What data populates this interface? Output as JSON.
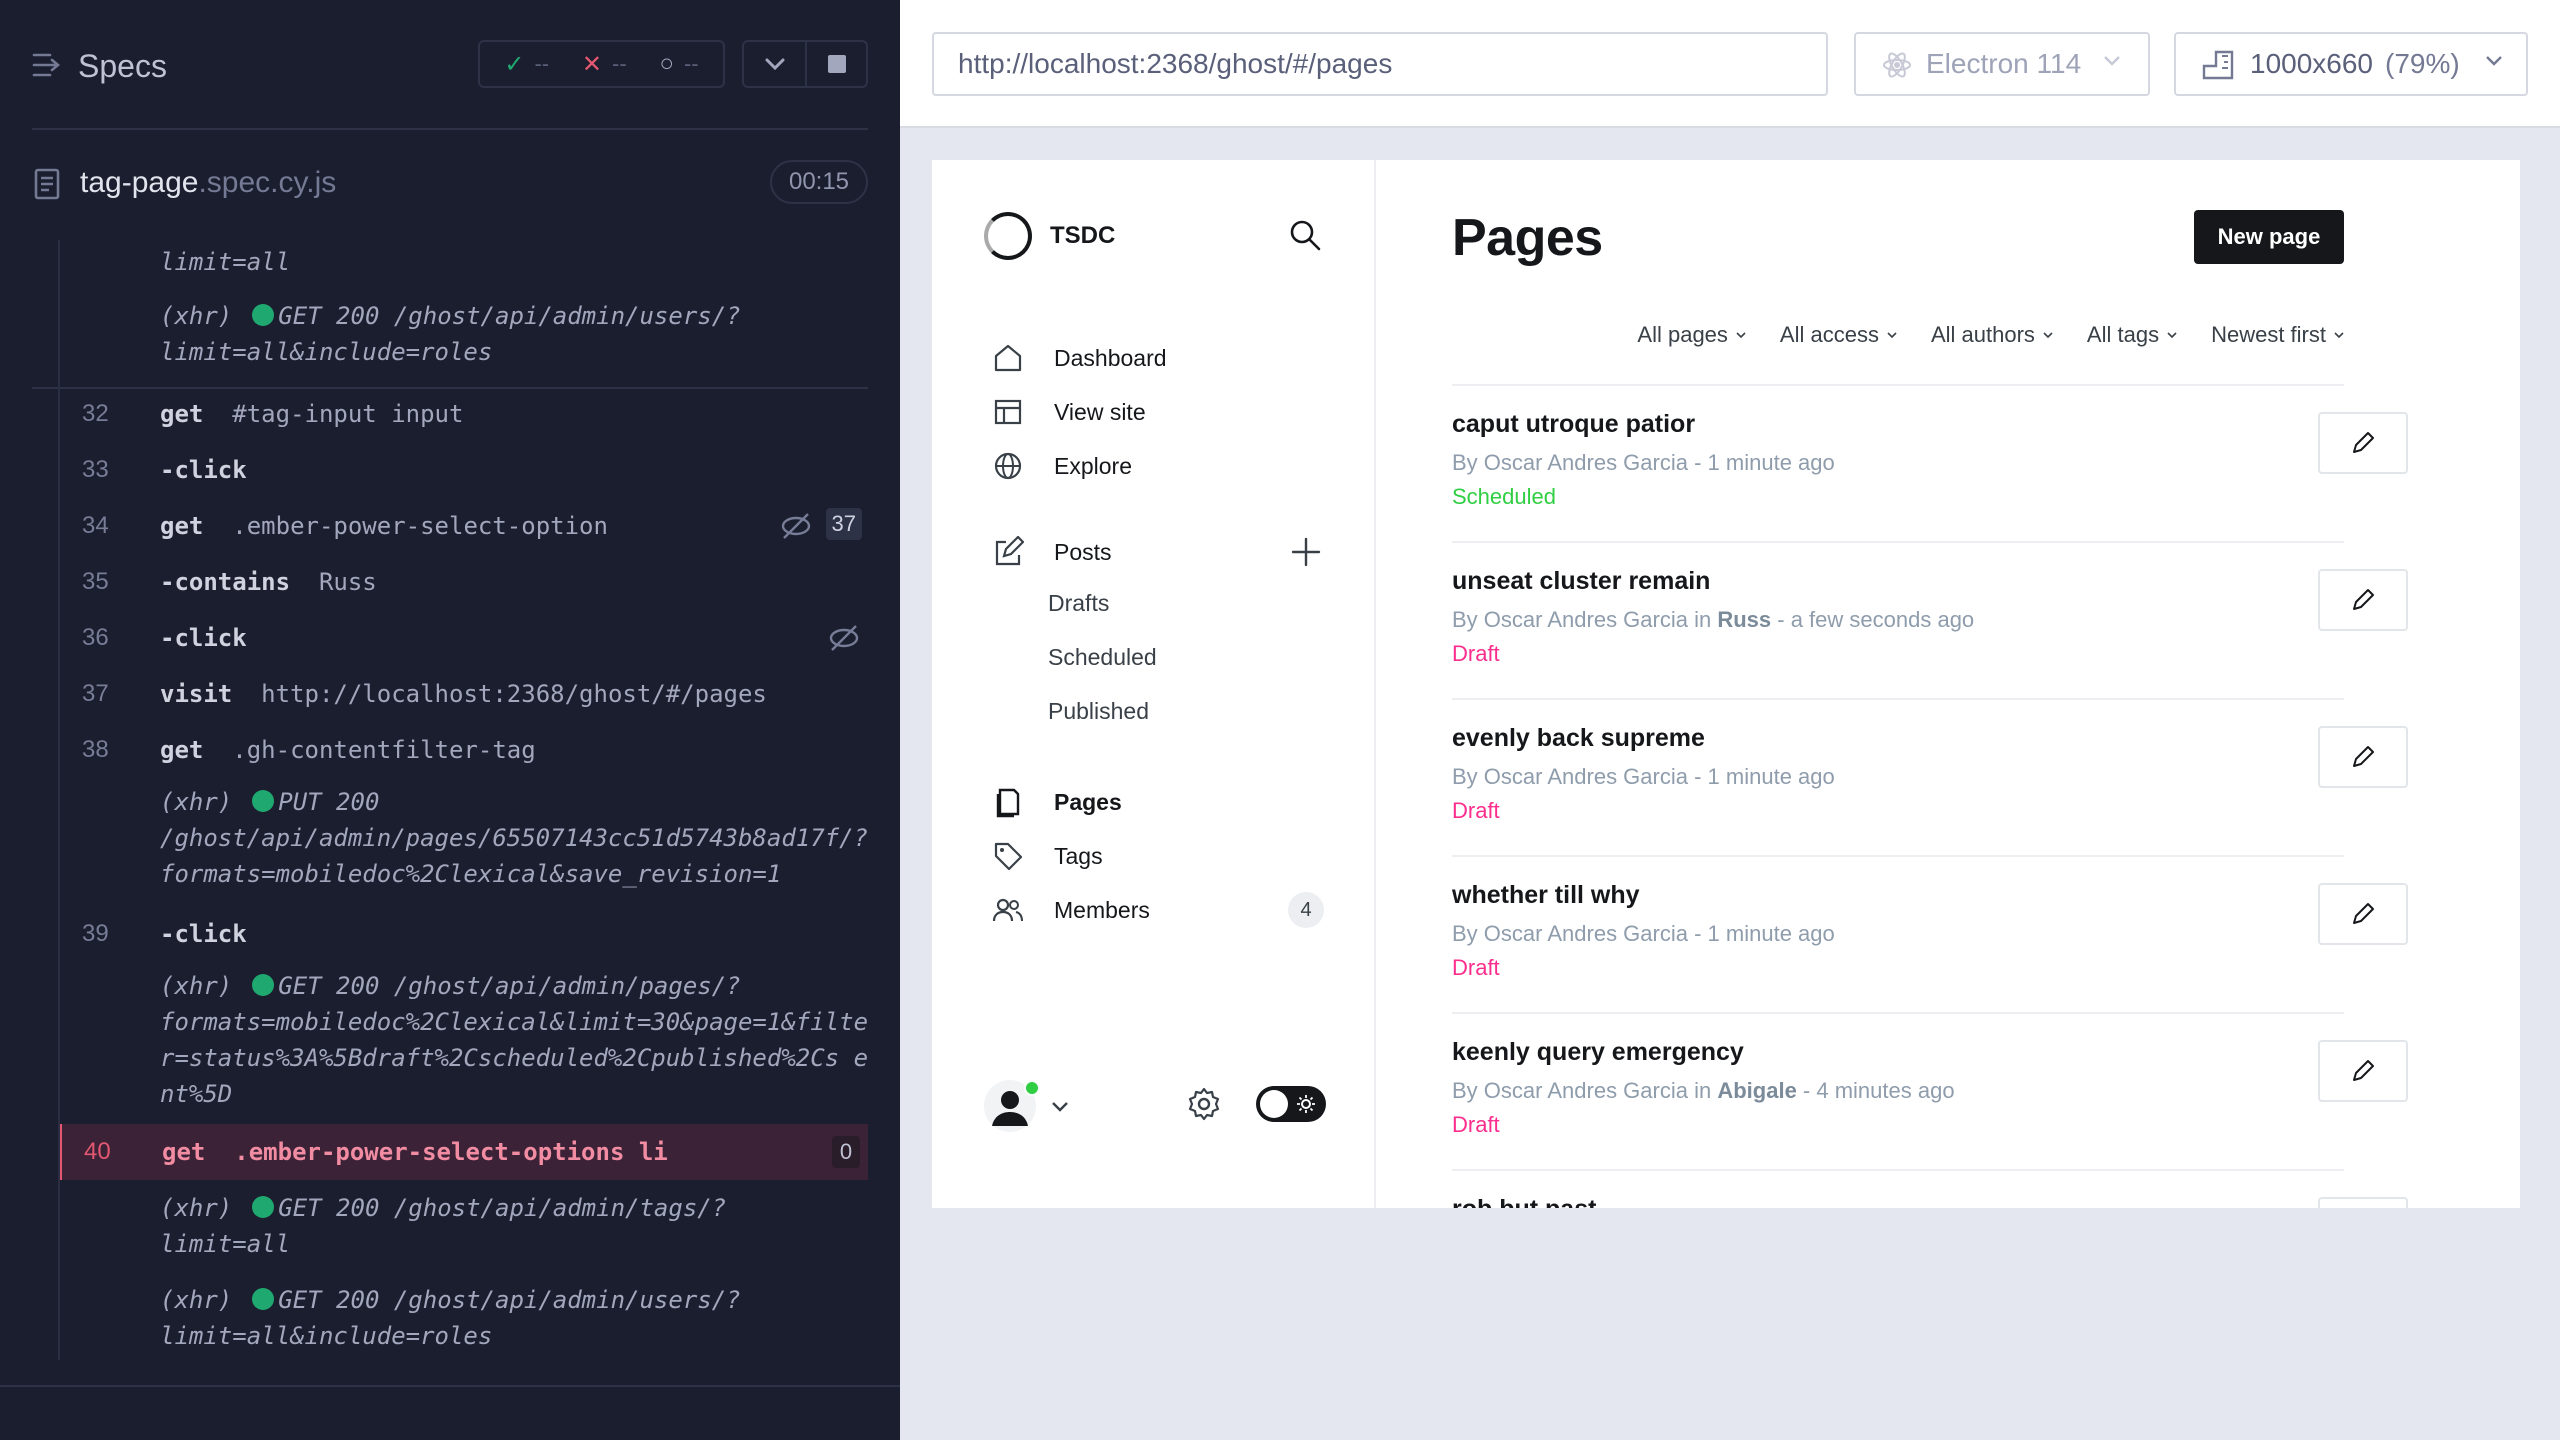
{
  "runner": {
    "title": "Specs",
    "stats": {
      "passed": "--",
      "failed": "--",
      "pending": "--"
    },
    "spec": {
      "name": "tag-page",
      "ext": ".spec.cy.js",
      "duration": "00:15"
    },
    "log": [
      {
        "type": "xhr",
        "text": "limit=all"
      },
      {
        "type": "xhr",
        "method": "GET 200 /ghost/api/admin/users/?",
        "cont": "limit=all&include=roles"
      },
      {
        "num": "32",
        "name": "get",
        "msg": "#tag-input input"
      },
      {
        "num": "33",
        "name": "-click",
        "msg": ""
      },
      {
        "num": "34",
        "name": "get",
        "msg": ".ember-power-select-option",
        "badge": "37"
      },
      {
        "num": "35",
        "name": "-contains",
        "msg": "Russ"
      },
      {
        "num": "36",
        "name": "-click",
        "msg": ""
      },
      {
        "num": "37",
        "name": "visit",
        "msg": "http://localhost:2368/ghost/#/pages"
      },
      {
        "num": "38",
        "name": "get",
        "msg": ".gh-contentfilter-tag"
      },
      {
        "type": "xhr",
        "method": "PUT 200",
        "cont": "/ghost/api/admin/pages/65507143cc51d5743b8ad17f/?formats=mobiledoc%2Clexical&save_revision=1"
      },
      {
        "num": "39",
        "name": "-click",
        "msg": ""
      },
      {
        "type": "xhr",
        "method": "GET 200 /ghost/api/admin/pages/?",
        "cont": "formats=mobiledoc%2Clexical&limit=30&page=1&filter=status%3A%5Bdraft%2Cscheduled%2Cpublished%2Cs ent%5D"
      },
      {
        "num": "40",
        "name": "get",
        "msg": ".ember-power-select-options li",
        "badge": "0"
      },
      {
        "type": "xhr",
        "method": "GET 200 /ghost/api/admin/tags/?",
        "cont": "limit=all"
      },
      {
        "type": "xhr",
        "method": "GET 200 /ghost/api/admin/users/?",
        "cont": "limit=all&include=roles"
      }
    ],
    "xhr_label": "(xhr)"
  },
  "aut": {
    "url": "http://localhost:2368/ghost/#/pages",
    "browser": "Electron 114",
    "viewport": "1000x660",
    "viewport_pct": "(79%)"
  },
  "ghost": {
    "site_name": "TSDC",
    "nav": {
      "dashboard": "Dashboard",
      "view_site": "View site",
      "explore": "Explore",
      "posts": "Posts",
      "drafts": "Drafts",
      "scheduled": "Scheduled",
      "published": "Published",
      "pages": "Pages",
      "tags": "Tags",
      "members": "Members",
      "members_count": "4"
    },
    "page_title": "Pages",
    "new_page": "New page",
    "filters": [
      "All pages",
      "All access",
      "All authors",
      "All tags",
      "Newest first"
    ],
    "posts": [
      {
        "title": "caput utroque patior",
        "author": "By Oscar Andres Garcia",
        "tag": "",
        "time": "1 minute ago",
        "status": "Scheduled"
      },
      {
        "title": "unseat cluster remain",
        "author": "By Oscar Andres Garcia",
        "tag": "Russ",
        "time": "a few seconds ago",
        "status": "Draft"
      },
      {
        "title": "evenly back supreme",
        "author": "By Oscar Andres Garcia",
        "tag": "",
        "time": "1 minute ago",
        "status": "Draft"
      },
      {
        "title": "whether till why",
        "author": "By Oscar Andres Garcia",
        "tag": "",
        "time": "1 minute ago",
        "status": "Draft"
      },
      {
        "title": "keenly query emergency",
        "author": "By Oscar Andres Garcia",
        "tag": "Abigale",
        "time": "4 minutes ago",
        "status": "Draft"
      },
      {
        "title": "rob but past",
        "author": "",
        "tag": "",
        "time": "",
        "status": ""
      }
    ],
    "colors": {
      "scheduled": "#30cf43",
      "draft": "#fb2d8d"
    }
  }
}
